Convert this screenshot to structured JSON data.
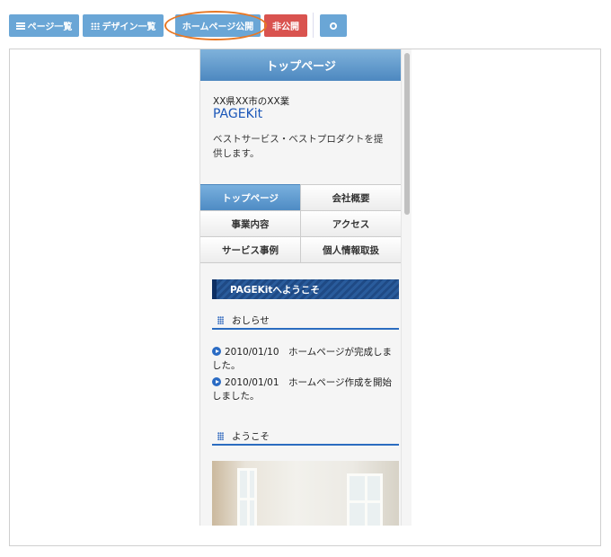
{
  "toolbar": {
    "page_list": "ページ一覧",
    "design_list": "デザイン一覧",
    "publish": "ホームページ公開",
    "unpublish": "非公開",
    "settings_icon": "gear-icon"
  },
  "preview": {
    "header_title": "トップページ",
    "company": "XX県XX市のXX業",
    "brand": "PAGEKit",
    "description": "ベストサービス・ベストプロダクトを提供します。",
    "nav": [
      {
        "label": "トップページ",
        "active": true
      },
      {
        "label": "会社概要",
        "active": false
      },
      {
        "label": "事業内容",
        "active": false
      },
      {
        "label": "アクセス",
        "active": false
      },
      {
        "label": "サービス事例",
        "active": false
      },
      {
        "label": "個人情報取扱",
        "active": false
      }
    ],
    "welcome_banner": "PAGEKitへようこそ",
    "news_heading": "おしらせ",
    "news": [
      "2010/01/10　ホームページが完成しました。",
      "2010/01/01　ホームページ作成を開始しました。"
    ],
    "welcome_heading": "ようこそ"
  },
  "colors": {
    "accent_blue": "#6aa6d6",
    "danger_red": "#d9534f",
    "highlight_orange": "#e87825",
    "link_blue": "#1a56b8"
  }
}
